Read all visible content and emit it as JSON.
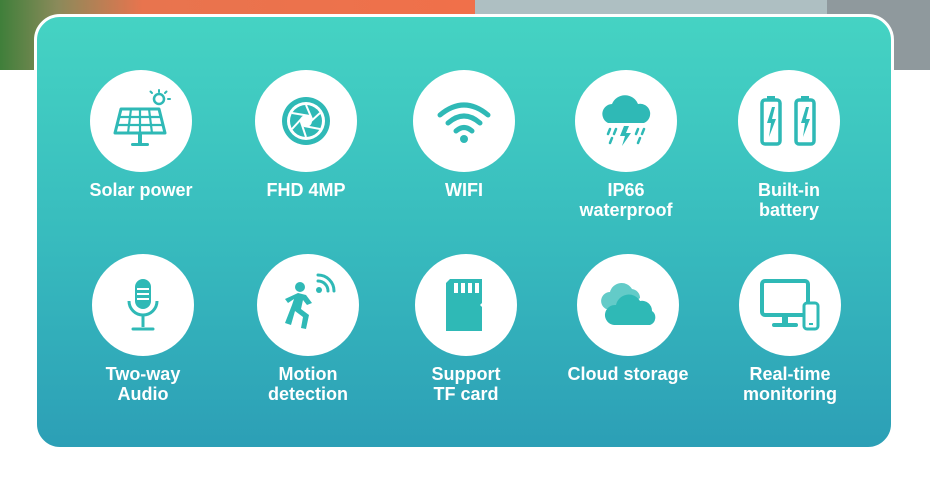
{
  "colors": {
    "accent": "#2fb9b6",
    "panel_top": "#45d3c3",
    "panel_bottom": "#2c9fb6",
    "text": "#ffffff"
  },
  "features": [
    {
      "icon": "solar-panel-icon",
      "label": [
        "Solar power"
      ]
    },
    {
      "icon": "camera-aperture-icon",
      "label": [
        "FHD 4MP"
      ]
    },
    {
      "icon": "wifi-icon",
      "label": [
        "WIFI"
      ]
    },
    {
      "icon": "rain-cloud-icon",
      "label": [
        "IP66",
        "waterproof"
      ]
    },
    {
      "icon": "battery-icon",
      "label": [
        "Built-in",
        "battery"
      ]
    },
    {
      "icon": "microphone-icon",
      "label": [
        "Two-way",
        "Audio"
      ]
    },
    {
      "icon": "motion-sensor-icon",
      "label": [
        "Motion",
        "detection"
      ]
    },
    {
      "icon": "sd-card-icon",
      "label": [
        "Support",
        "TF card"
      ]
    },
    {
      "icon": "cloud-icon",
      "label": [
        "Cloud storage"
      ]
    },
    {
      "icon": "monitor-phone-icon",
      "label": [
        "Real-time",
        "monitoring"
      ]
    }
  ]
}
